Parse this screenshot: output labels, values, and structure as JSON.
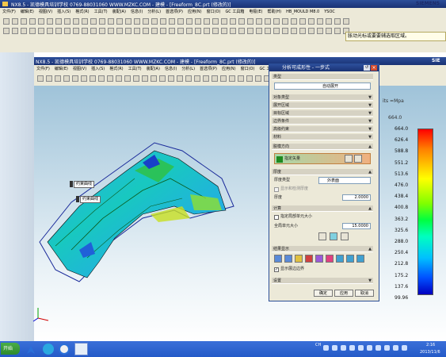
{
  "outer_window": {
    "title": "NX8.5 - 凯德模具培训学校  0769-88031060  WWW.MZKC.COM - 建模 - [Freeform_8C.prt (修改的)]",
    "brand": "SIEMENS",
    "menu": [
      "文件(F)",
      "编辑(E)",
      "视图(V)",
      "插入(S)",
      "格式(R)",
      "工具(T)",
      "装配(A)",
      "信息(I)",
      "分析(L)",
      "首选项(P)",
      "应用(N)",
      "窗口(O)",
      "GC 工具箱",
      "电极(E)",
      "帮助(H)",
      "HB_MOULD M8.0",
      "YSOC"
    ],
    "hint": "胀动光标或要要辅选取区域。"
  },
  "inner_window": {
    "title": "NX8.5 - 凯德模具培训学校  0769-88031060  WWW.MZKC.COM - 建模 - [Freeform_8C.prt (修改的)]",
    "brand": "SIE",
    "menu": [
      "文件(F)",
      "编辑(E)",
      "视图(V)",
      "插入(S)",
      "格式(R)",
      "工具(T)",
      "装配(A)",
      "信息(I)",
      "分析(L)",
      "首选项(P)",
      "应用(N)",
      "窗口(O)",
      "GC 工"
    ]
  },
  "dialog": {
    "title": "分析可成形性 - 一步式",
    "type_section": "类型",
    "type_value": "自动展开",
    "sections": [
      "对象类型",
      "展开区域",
      "目标区域",
      "边界条件",
      "高级约束",
      "材料"
    ],
    "direction_section": "脱模方向",
    "direction_label": "指定矢量",
    "thickness_section": "厚度",
    "thickness_type_label": "厚度类型",
    "thickness_type_value": "外表面",
    "check_thickness_label": "显示和检测厚度",
    "thickness_label": "厚度",
    "thickness_value": "2.0000",
    "calc_section": "计算",
    "calc_check_label": "指定局部单元大小",
    "global_size_label": "全局单元大小",
    "global_size_value": "15.0000",
    "result_section": "结果显示",
    "show_boundary_label": "显示展边边界",
    "settings_section": "设置",
    "ok": "确定",
    "apply": "应用",
    "cancel": "取消"
  },
  "viewport": {
    "annotation_1": "约束曲线",
    "annotation_2": "约束曲线",
    "legend_title": "its =Mpa",
    "legend_top": "664.0",
    "legend_values": [
      "664.0",
      "626.4",
      "588.8",
      "551.2",
      "513.6",
      "476.0",
      "438.4",
      "400.8",
      "363.2",
      "325.6",
      "288.0",
      "250.4",
      "212.8",
      "175.2",
      "137.6",
      "99.96"
    ]
  },
  "taskbar": {
    "start": "开始",
    "tray_lang": "CH",
    "time": "2:16",
    "date": "2013/11/6"
  }
}
